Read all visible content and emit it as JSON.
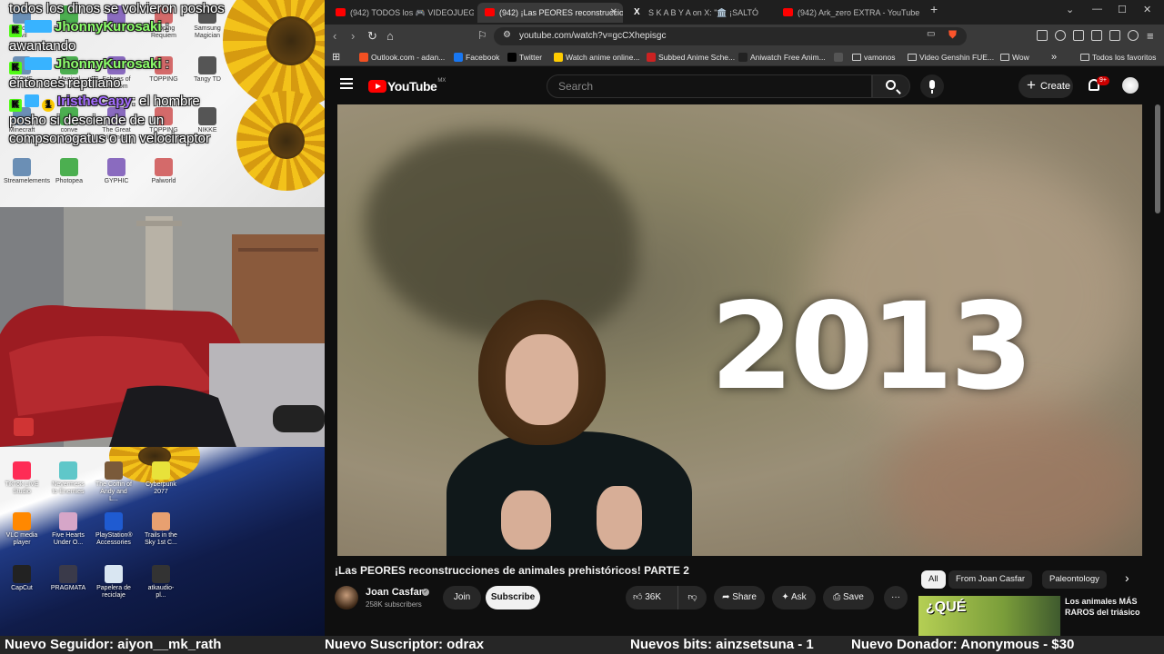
{
  "chat": {
    "lines": [
      {
        "text": "todos los dinos se volvieron poshos"
      },
      {
        "user": "JhonnyKurosaki",
        "message": ":"
      },
      {
        "text": "awantando"
      },
      {
        "user": "JhonnyKurosaki",
        "message": ":"
      },
      {
        "text": "entonces reptiiano"
      },
      {
        "user": "IristheCapy",
        "message": ": el hombre"
      },
      {
        "text": "posho si desciende de un"
      },
      {
        "text": "compsonogatus o un velociraptor"
      }
    ]
  },
  "desktop_top": {
    "icons": [
      {
        "label": "Resident Evil"
      },
      {
        "label": "Bluestacks"
      },
      {
        "label": "Brows Dust2"
      },
      {
        "label": "Topping Requiem"
      },
      {
        "label": "Samsung Magician"
      },
      {
        "label": "STOVE"
      },
      {
        "label": "Magical Princess"
      },
      {
        "label": "Echoes of Wisdom"
      },
      {
        "label": "TOPPING"
      },
      {
        "label": "Tangy TD"
      },
      {
        "label": "Minecraft Launcher"
      },
      {
        "label": "conve"
      },
      {
        "label": "The Great Villainess"
      },
      {
        "label": "TOPPING Profession..."
      },
      {
        "label": "NIKKE"
      },
      {
        "label": "Streamelements"
      },
      {
        "label": "Photopea"
      },
      {
        "label": "GYPHIC"
      },
      {
        "label": "Palworld"
      }
    ]
  },
  "desktop_bottom": {
    "icons": [
      {
        "label": "TikTok LIVE Studio",
        "color": "#fe2c55"
      },
      {
        "label": "Nevermess to Enemies",
        "color": "#5fc7c9"
      },
      {
        "label": "The Coffin of Andy and L...",
        "color": "#7a5a3a"
      },
      {
        "label": "Cyberpunk 2077",
        "color": "#e8e23a"
      },
      {
        "label": "VLC media player",
        "color": "#ff8800"
      },
      {
        "label": "Five Hearts Under O...",
        "color": "#d6a6c8"
      },
      {
        "label": "PlayStation® Accessories",
        "color": "#1f5bd1"
      },
      {
        "label": "Trails in the Sky 1st C...",
        "color": "#e8a070"
      },
      {
        "label": "CapCut",
        "color": "#222222"
      },
      {
        "label": "PRAGMATA",
        "color": "#3a3a4a"
      },
      {
        "label": "Papelera de reciclaje",
        "color": "#d9e6f2"
      },
      {
        "label": "atkaudio-pl...",
        "color": "#333333"
      }
    ]
  },
  "browser": {
    "tabs": [
      {
        "label": "(942) TODOS los 🎮 VIDEOJUEGOS 🎮",
        "active": false,
        "icon": "youtube-icon"
      },
      {
        "label": "(942) ¡Las PEORES reconstruccio",
        "active": true,
        "icon": "youtube-icon"
      },
      {
        "label": "S K A B Y A on X: \"🏛️ ¡SALTÓ",
        "active": false,
        "icon": "x-icon"
      },
      {
        "label": "(942) Ark_zero EXTRA - YouTube",
        "active": false,
        "icon": "youtube-icon"
      }
    ],
    "new_tab": "+",
    "url": "youtube.com/watch?v=gcCXhepisgc",
    "bookmarks": [
      {
        "label": "Outlook.com - adan...",
        "color": "#f25022"
      },
      {
        "label": "Facebook",
        "color": "#1877f2"
      },
      {
        "label": "Twitter",
        "color": "#000000"
      },
      {
        "label": "Watch anime online...",
        "color": "#ffcc00"
      },
      {
        "label": "Subbed Anime Sche...",
        "color": "#cc2222"
      },
      {
        "label": "Aniwatch Free Anim...",
        "color": "#222222"
      },
      {
        "label": "",
        "color": "#555555"
      },
      {
        "label": "vamonos",
        "color": "folder"
      },
      {
        "label": "Video Genshin FUE...",
        "color": "folder"
      },
      {
        "label": "Wow",
        "color": "folder"
      }
    ],
    "bookmarks_more": "»",
    "all_bookmarks": "Todos los favoritos"
  },
  "youtube": {
    "logo_text": "YouTube",
    "country": "MX",
    "search_placeholder": "Search",
    "create_label": "Create",
    "notifications": "9+",
    "video_overlay_text": "2013",
    "title": "¡Las PEORES reconstrucciones de animales prehistóricos! PARTE 2",
    "channel": {
      "name": "Joan Casfar",
      "subscribers": "258K subscribers",
      "join": "Join",
      "subscribe": "Subscribe"
    },
    "actions": {
      "likes": "36K",
      "share": "Share",
      "ask": "Ask",
      "save": "Save",
      "more": "···"
    },
    "chips": [
      {
        "label": "All",
        "selected": true
      },
      {
        "label": "From Joan Casfar",
        "selected": false
      },
      {
        "label": "Paleontology",
        "selected": false
      }
    ],
    "chips_next": "›",
    "recommendation": {
      "thumb_text": "¿QUÉ",
      "title": "Los animales MÁS RAROS del triásico"
    }
  },
  "ticker": {
    "follower": "Nuevo Seguidor: aiyon__mk_rath",
    "subscriber": "Nuevo Suscriptor: odrax",
    "bits": "Nuevos bits: ainzsetsuna - 1",
    "donor": "Nuevo Donador: Anonymous - $30"
  }
}
